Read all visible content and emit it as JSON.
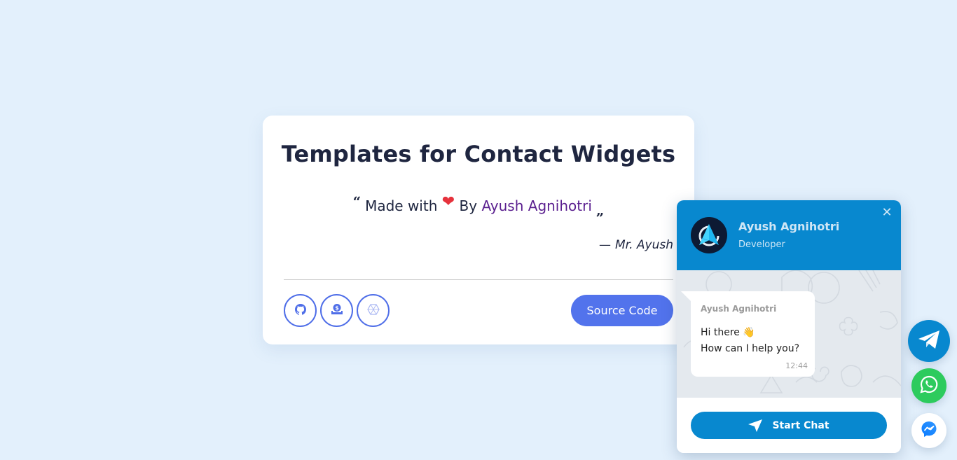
{
  "card": {
    "title": "Templates for Contact Widgets",
    "quote": {
      "open_mark": "“",
      "prefix": "Made with",
      "heart": "❤",
      "by": "By",
      "author": "Ayush Agnihotri",
      "close_mark": "„"
    },
    "signature": {
      "dash": "—",
      "name": "Mr. Ayush"
    },
    "icon_buttons": [
      {
        "icon": "github-icon"
      },
      {
        "icon": "donate-icon"
      },
      {
        "icon": "hexagon-icon"
      }
    ],
    "source_code_label": "Source Code"
  },
  "chat_widget": {
    "header": {
      "name": "Ayush Agnihotri",
      "role": "Developer",
      "close_glyph": "✕"
    },
    "message": {
      "sender": "Ayush Agnihotri",
      "line1": "Hi there 👋",
      "line2": "How can I help you?",
      "time": "12:44"
    },
    "start_chat_label": "Start Chat"
  },
  "floating_buttons": [
    {
      "name": "telegram",
      "color": "#0888cf"
    },
    {
      "name": "whatsapp",
      "color": "#2dcb5d"
    },
    {
      "name": "messenger",
      "color": "#ffffff"
    }
  ],
  "colors": {
    "background": "#e3f0fc",
    "accent": "#5273ec",
    "chat_blue": "#0888cf",
    "author_link": "#5a1f8f"
  }
}
